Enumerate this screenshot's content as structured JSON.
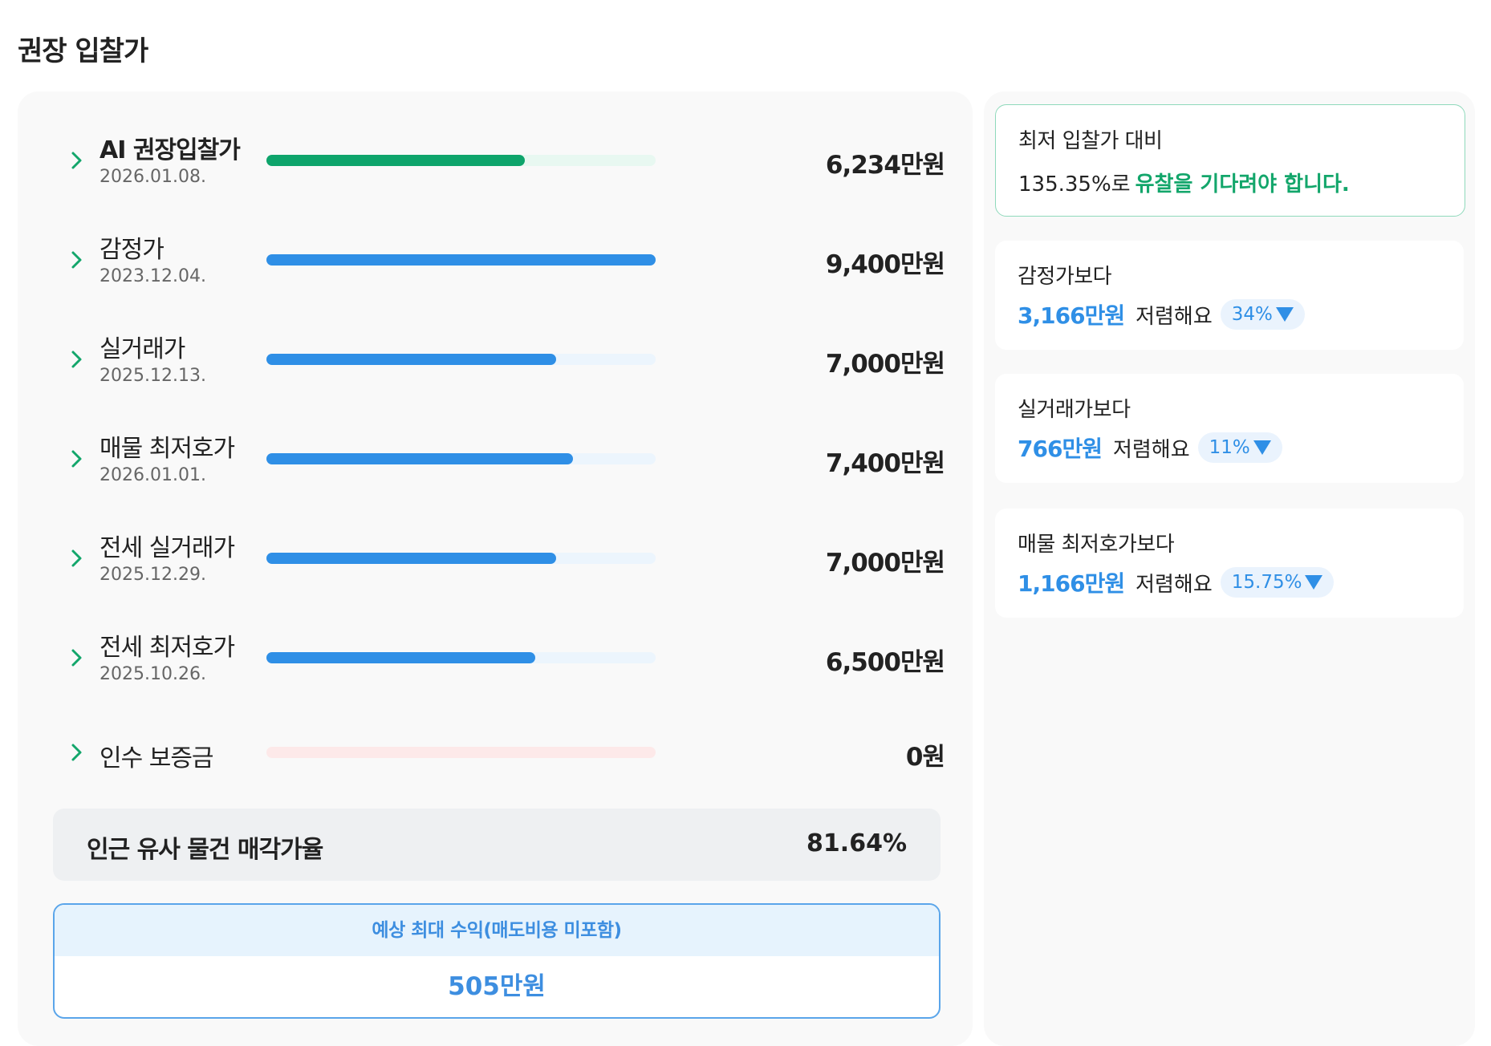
{
  "page_title": "권장 입찰가",
  "rows": [
    {
      "label": "AI 권장입찰가",
      "date": "2026.01.08.",
      "value": "6,234만원",
      "ratio": 0.663,
      "fill_color": "#0ea46b",
      "track_color": "#e8f8f1"
    },
    {
      "label": "감정가",
      "date": "2023.12.04.",
      "value": "9,400만원",
      "ratio": 1.0,
      "fill_color": "#2f8fe6",
      "track_color": "#ecf5fd"
    },
    {
      "label": "실거래가",
      "date": "2025.12.13.",
      "value": "7,000만원",
      "ratio": 0.745,
      "fill_color": "#2f8fe6",
      "track_color": "#ecf5fd"
    },
    {
      "label": "매물 최저호가",
      "date": "2026.01.01.",
      "value": "7,400만원",
      "ratio": 0.787,
      "fill_color": "#2f8fe6",
      "track_color": "#ecf5fd"
    },
    {
      "label": "전세 실거래가",
      "date": "2025.12.29.",
      "value": "7,000만원",
      "ratio": 0.745,
      "fill_color": "#2f8fe6",
      "track_color": "#ecf5fd"
    },
    {
      "label": "전세 최저호가",
      "date": "2025.10.26.",
      "value": "6,500만원",
      "ratio": 0.691,
      "fill_color": "#2f8fe6",
      "track_color": "#ecf5fd"
    },
    {
      "label": "인수 보증금",
      "date": "",
      "value": "0원",
      "ratio": 0.0,
      "fill_color": "#f7a6a6",
      "track_color": "#fde9e9"
    }
  ],
  "sale_rate": {
    "label": "인근 유사 물건 매각가율",
    "value": "81.64%"
  },
  "profit": {
    "label": "예상 최대 수익(매도비용 미포함)",
    "value": "505만원"
  },
  "lowest_compare": {
    "title": "최저 입찰가 대비",
    "percent": "135.35%로",
    "message": "유찰을 기다려야 합니다."
  },
  "comparisons": [
    {
      "title": "감정가보다",
      "amount": "3,166만원",
      "suffix": "저렴해요",
      "percent": "34%"
    },
    {
      "title": "실거래가보다",
      "amount": "766만원",
      "suffix": "저렴해요",
      "percent": "11%"
    },
    {
      "title": "매물 최저호가보다",
      "amount": "1,166만원",
      "suffix": "저렴해요",
      "percent": "15.75%"
    }
  ],
  "colors": {
    "accent_green": "#13a66b",
    "accent_blue": "#2f8fe6",
    "chevron_green": "#13a66b"
  }
}
